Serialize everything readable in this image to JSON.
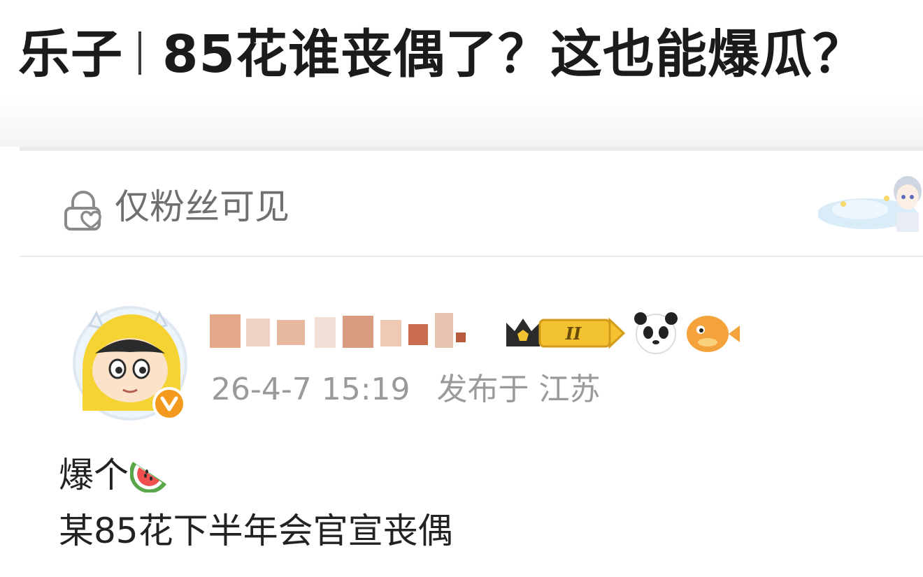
{
  "headline": {
    "tag": "乐子",
    "title": "85花谁丧偶了？这也能爆瓜？"
  },
  "post": {
    "visibility_icon": "lock-heart-icon",
    "visibility_label": "仅粉丝可见",
    "author": {
      "avatar": "cartoon-avatar-with-verified-badge",
      "name_blurred": true,
      "badges": [
        "crown-level-badge",
        "panda-emoji-icon",
        "pufferfish-emoji-icon"
      ],
      "level_badge_text": "II"
    },
    "timestamp": "26-4-7 15:19",
    "location": "发布于 江苏",
    "content": {
      "line1": "爆个",
      "line1_icon": "watermelon-icon",
      "line2": "某85花下半年会官宣丧偶"
    }
  },
  "colors": {
    "title_text": "#1b1b1b",
    "muted_text": "#9a9a9a",
    "badge_gold": "#f2c230",
    "verified_orange": "#f39a1d"
  }
}
